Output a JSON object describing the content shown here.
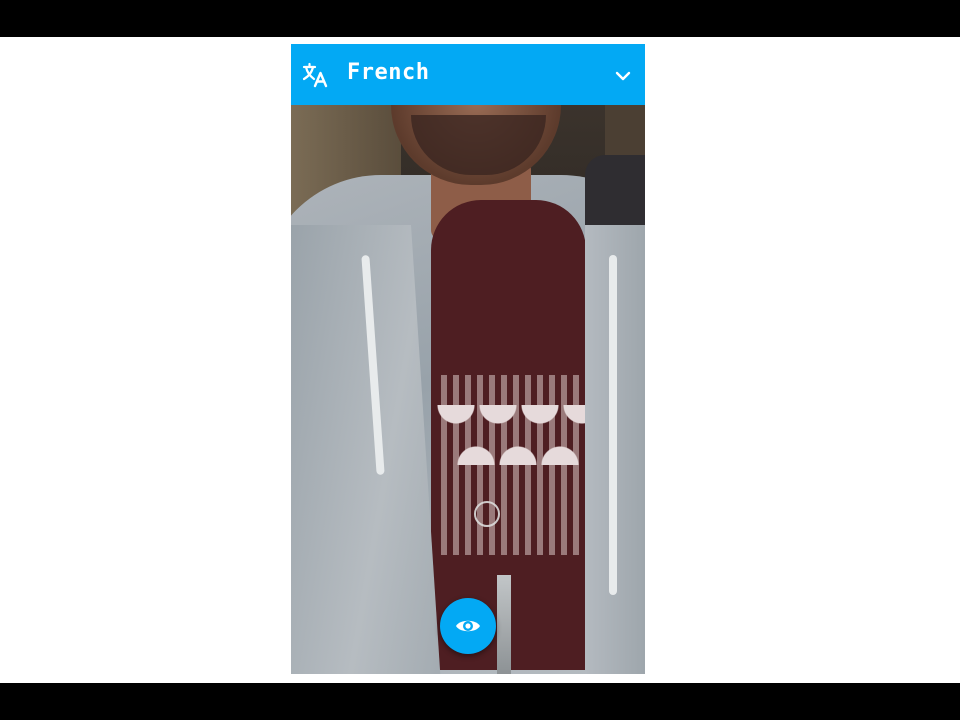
{
  "app_bar": {
    "language_label": "French",
    "translate_icon": "translate-icon",
    "dropdown_icon": "chevron-down-icon"
  },
  "fab": {
    "icon": "eye-icon"
  },
  "colors": {
    "accent": "#03a9f4",
    "text_on_accent": "#ffffff",
    "stage_bg": "#ffffff",
    "letterbox": "#000000"
  }
}
